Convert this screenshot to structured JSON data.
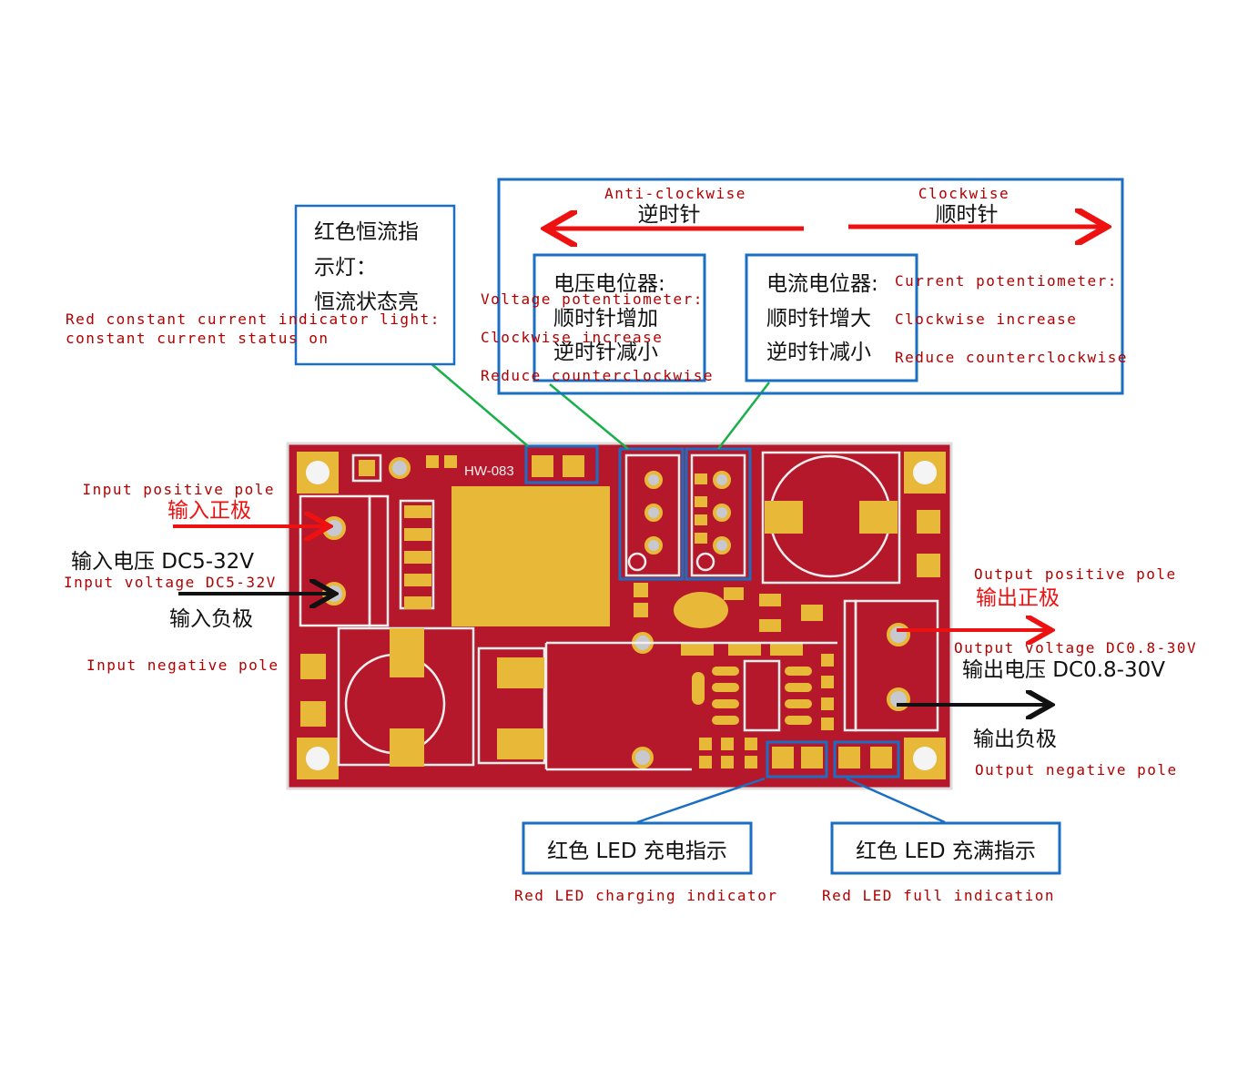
{
  "colors": {
    "pcb": "#b5182b",
    "pad": "#e8b838",
    "callout_box": "#1a6fc4",
    "leader_green": "#19b04a",
    "english_label": "#b00000",
    "red_arrow": "#ee1111"
  },
  "board": {
    "model": "HW-083"
  },
  "indicator_callout": {
    "cn_lines": [
      "红色恒流指",
      "示灯：",
      "恒流状态亮"
    ],
    "en_lines": [
      "Red constant current indicator light:",
      "constant current status on"
    ]
  },
  "direction": {
    "anticlockwise_en": "Anti-clockwise",
    "anticlockwise_cn": "逆时针",
    "clockwise_en": "Clockwise",
    "clockwise_cn": "顺时针"
  },
  "voltage_pot": {
    "cn_lines": [
      "电压电位器:",
      "顺时针增加",
      "逆时针减小"
    ],
    "en_lines": [
      "Voltage potentiometer:",
      "Clockwise increase",
      "Reduce counterclockwise"
    ]
  },
  "current_pot": {
    "cn_lines": [
      "电流电位器:",
      "顺时针增大",
      "逆时针减小"
    ],
    "en_lines": [
      "Current potentiometer:",
      "Clockwise increase",
      "Reduce counterclockwise"
    ]
  },
  "input": {
    "positive_en": "Input positive pole",
    "positive_cn": "输入正极",
    "voltage_cn": "输入电压 DC5-32V",
    "voltage_en": "Input voltage DC5-32V",
    "negative_cn": "输入负极",
    "negative_en": "Input negative pole"
  },
  "output": {
    "positive_en": "Output positive pole",
    "positive_cn": "输出正极",
    "voltage_en": "Output voltage DC0.8-30V",
    "voltage_cn": "输出电压 DC0.8-30V",
    "negative_cn": "输出负极",
    "negative_en": "Output negative pole"
  },
  "led_charging": {
    "cn": "红色 LED  充电指示",
    "en": "Red LED charging indicator"
  },
  "led_full": {
    "cn": "红色 LED  充满指示",
    "en": "Red LED full indication"
  }
}
